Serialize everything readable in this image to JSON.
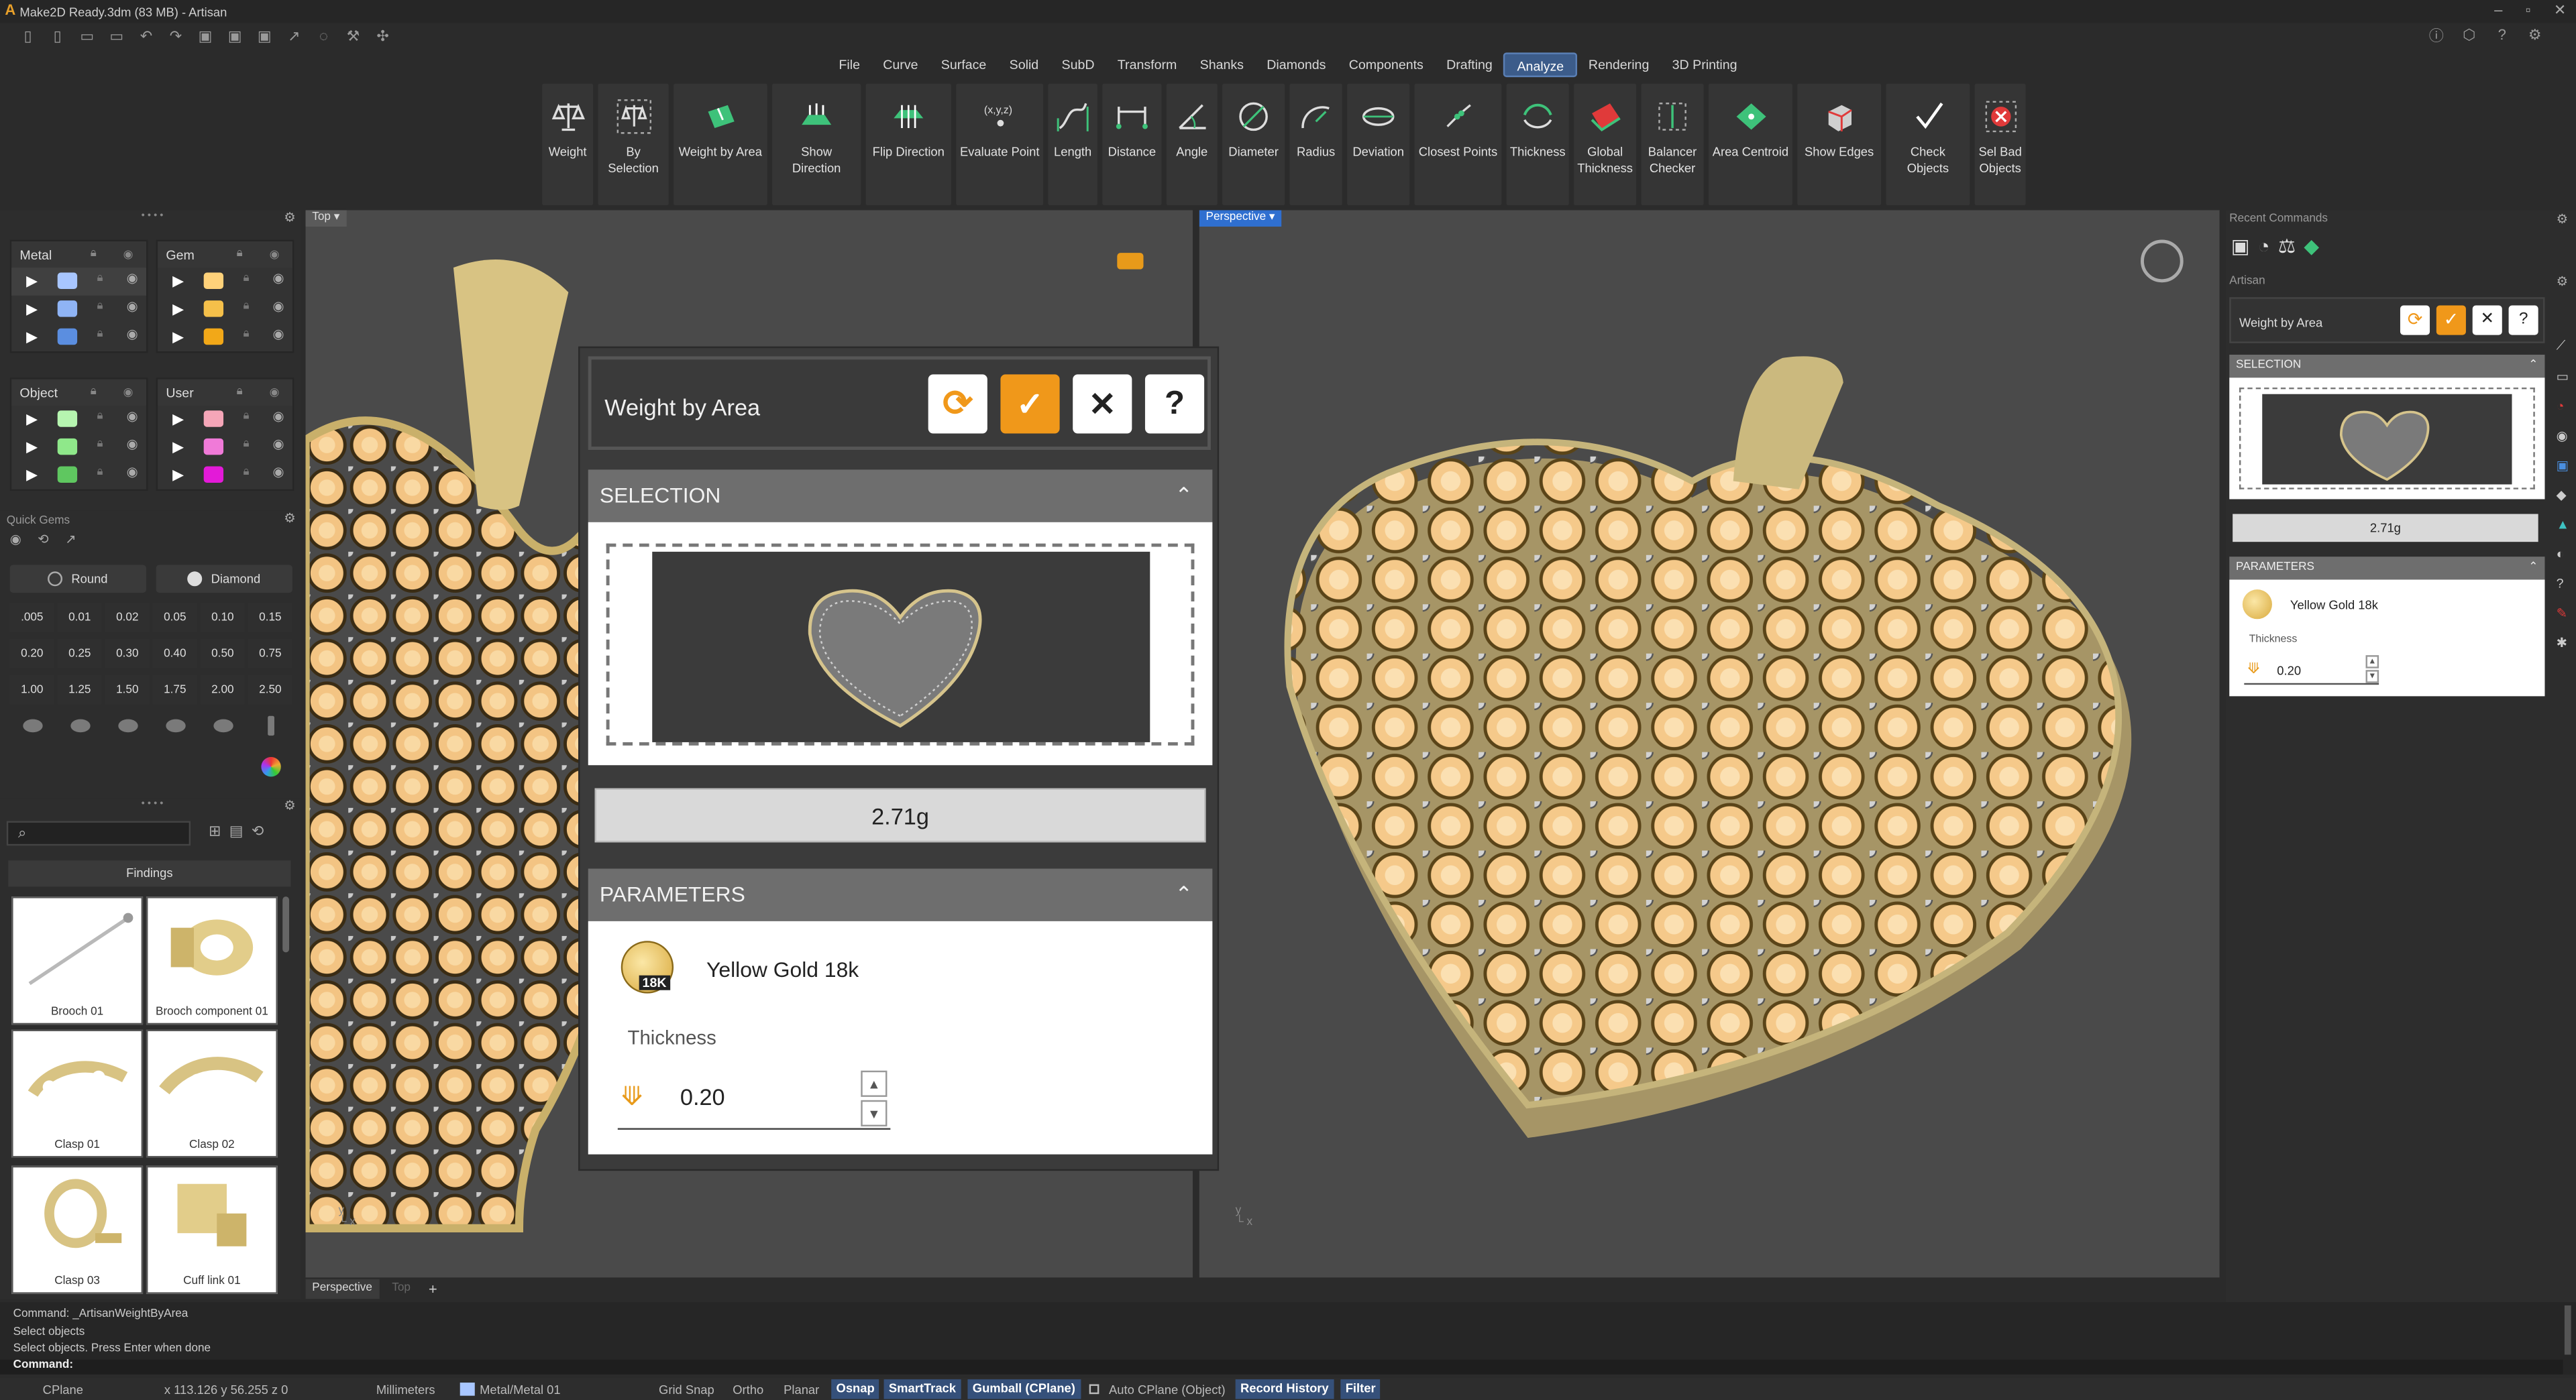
{
  "window": {
    "title": "Make2D Ready.3dm (83 MB) - Artisan"
  },
  "menu": {
    "tabs": [
      "File",
      "Curve",
      "Surface",
      "Solid",
      "SubD",
      "Transform",
      "Shanks",
      "Diamonds",
      "Components",
      "Drafting",
      "Analyze",
      "Rendering",
      "3D Printing"
    ],
    "active": "Analyze"
  },
  "ribbon": {
    "commands": [
      {
        "label": "Weight",
        "icon": "scale-icon"
      },
      {
        "label": "By Selection",
        "icon": "scale-selection-icon"
      },
      {
        "label": "Weight by Area",
        "icon": "weight-area-icon"
      },
      {
        "label": "Show Direction",
        "icon": "show-direction-icon"
      },
      {
        "label": "Flip Direction",
        "icon": "flip-direction-icon"
      },
      {
        "label": "Evaluate Point",
        "icon": "evaluate-point-icon"
      },
      {
        "label": "Length",
        "icon": "length-icon"
      },
      {
        "label": "Distance",
        "icon": "distance-icon"
      },
      {
        "label": "Angle",
        "icon": "angle-icon"
      },
      {
        "label": "Diameter",
        "icon": "diameter-icon"
      },
      {
        "label": "Radius",
        "icon": "radius-icon"
      },
      {
        "label": "Deviation",
        "icon": "deviation-icon"
      },
      {
        "label": "Closest Points",
        "icon": "closest-points-icon"
      },
      {
        "label": "Thickness",
        "icon": "thickness-icon"
      },
      {
        "label": "Global Thickness",
        "icon": "global-thickness-icon"
      },
      {
        "label": "Balancer Checker",
        "icon": "balancer-icon"
      },
      {
        "label": "Area Centroid",
        "icon": "area-centroid-icon"
      },
      {
        "label": "Show Edges",
        "icon": "show-edges-icon"
      },
      {
        "label": "Check Objects",
        "icon": "check-icon"
      },
      {
        "label": "Sel Bad Objects",
        "icon": "bad-objects-icon"
      }
    ]
  },
  "layers": {
    "groups": [
      {
        "name": "Metal",
        "colors": [
          "#a8c6ff",
          "#8fb4f5",
          "#5b8ee0"
        ]
      },
      {
        "name": "Gem",
        "colors": [
          "#ffd27a",
          "#f5c04a",
          "#f2a818"
        ]
      },
      {
        "name": "Object",
        "colors": [
          "#b6f5b0",
          "#8fe88a",
          "#5fc760"
        ]
      },
      {
        "name": "User",
        "colors": [
          "#f5a6b8",
          "#f07ad8",
          "#e31ad8"
        ]
      }
    ]
  },
  "quick_gems": {
    "title": "Quick Gems",
    "shape": "Round",
    "material": "Diamond",
    "sizes": [
      ".005",
      "0.01",
      "0.02",
      "0.05",
      "0.10",
      "0.15",
      "0.20",
      "0.25",
      "0.30",
      "0.40",
      "0.50",
      "0.75",
      "1.00",
      "1.25",
      "1.50",
      "1.75",
      "2.00",
      "2.50"
    ]
  },
  "library": {
    "category": "Findings",
    "items": [
      "Brooch 01",
      "Brooch component 01",
      "Clasp 01",
      "Clasp 02",
      "Clasp 03",
      "Cuff link 01"
    ]
  },
  "viewports": {
    "left_label": "Top",
    "right_label": "Perspective",
    "bottom_tabs": [
      "Perspective",
      "Top"
    ]
  },
  "dialog": {
    "title": "Weight by Area",
    "selection_header": "SELECTION",
    "result": "2.71g",
    "parameters_header": "PARAMETERS",
    "material": "Yellow Gold 18k",
    "material_badge": "18K",
    "thickness_label": "Thickness",
    "thickness_value": "0.20"
  },
  "right_panel": {
    "recent_title": "Recent Commands",
    "artisan_title": "Artisan"
  },
  "command": {
    "history": [
      "Command: _ArtisanWeightByArea",
      "Select objects",
      "Select objects. Press Enter when done"
    ],
    "prompt": "Command:"
  },
  "status": {
    "cplane": "CPlane",
    "coords": "x 113.126  y 56.255  z 0",
    "units": "Millimeters",
    "layer": "Metal/Metal 01",
    "toggles": [
      "Grid Snap",
      "Ortho",
      "Planar"
    ],
    "highlighted": [
      "Osnap",
      "SmartTrack",
      "Gumball (CPlane)"
    ],
    "auto_cplane": "Auto CPlane (Object)",
    "record": "Record History",
    "filter": "Filter"
  },
  "colors": {
    "accent": "#f0981a",
    "active_tab": "#3c5c8a",
    "gold": "#e8b35a"
  }
}
